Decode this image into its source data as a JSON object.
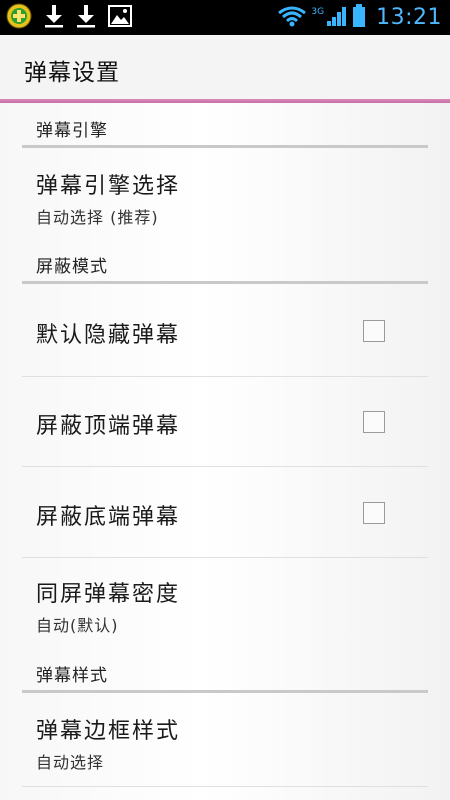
{
  "status_bar": {
    "time": "13:21",
    "network": "3G",
    "left_icons": [
      "app-icon",
      "download-icon",
      "download-icon",
      "image-icon"
    ],
    "right_icons": [
      "wifi-icon",
      "signal-icon",
      "battery-icon"
    ]
  },
  "header": {
    "title": "弹幕设置"
  },
  "sections": [
    {
      "title": "弹幕引擎",
      "items": [
        {
          "label": "弹幕引擎选择",
          "summary": "自动选择 (推荐)"
        }
      ]
    },
    {
      "title": "屏蔽模式",
      "items": [
        {
          "label": "默认隐藏弹幕",
          "checked": false
        },
        {
          "label": "屏蔽顶端弹幕",
          "checked": false
        },
        {
          "label": "屏蔽底端弹幕",
          "checked": false
        },
        {
          "label": "同屏弹幕密度",
          "summary": "自动(默认)"
        }
      ]
    },
    {
      "title": "弹幕样式",
      "items": [
        {
          "label": "弹幕边框样式",
          "summary": "自动选择"
        }
      ]
    }
  ],
  "colors": {
    "accent_underline": "#c76fa6",
    "time_blue": "#4db8ff",
    "status_green": "#2ecc71"
  }
}
